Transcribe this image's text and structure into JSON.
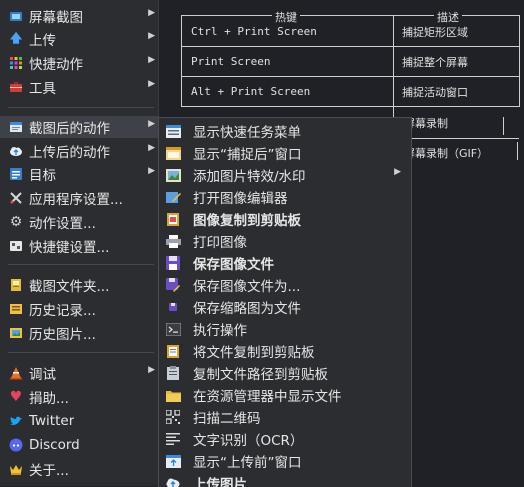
{
  "hotkeys": {
    "header_key": "热键",
    "header_desc": "描述",
    "rows": [
      {
        "key": "Ctrl + Print Screen",
        "desc": "捕捉矩形区域"
      },
      {
        "key": "Print Screen",
        "desc": "捕捉整个屏幕"
      },
      {
        "key": "Alt + Print Screen",
        "desc": "捕捉活动窗口"
      },
      {
        "key": "",
        "desc": "屏幕录制"
      },
      {
        "key": "",
        "desc": "屏幕录制（GIF）"
      }
    ]
  },
  "menu": {
    "items": [
      {
        "label": "屏幕截图",
        "icon": "screenshot-icon",
        "arrow": true
      },
      {
        "label": "上传",
        "icon": "upload-arrow-icon",
        "arrow": true
      },
      {
        "label": "快捷动作",
        "icon": "quick-actions-icon",
        "arrow": true
      },
      {
        "label": "工具",
        "icon": "toolbox-icon",
        "arrow": true
      },
      {
        "label": "截图后的动作",
        "icon": "after-capture-icon",
        "arrow": true
      },
      {
        "label": "上传后的动作",
        "icon": "cloud-icon",
        "arrow": true
      },
      {
        "label": "目标",
        "icon": "destination-icon",
        "arrow": true
      },
      {
        "label": "应用程序设置...",
        "icon": "wrench-icon",
        "arrow": false
      },
      {
        "label": "动作设置...",
        "icon": "gear-icon",
        "arrow": false
      },
      {
        "label": "快捷键设置...",
        "icon": "keyboard-icon",
        "arrow": false
      },
      {
        "label": "截图文件夹...",
        "icon": "folder-icon",
        "arrow": false
      },
      {
        "label": "历史记录...",
        "icon": "history-icon",
        "arrow": false
      },
      {
        "label": "历史图片...",
        "icon": "image-history-icon",
        "arrow": false
      },
      {
        "label": "调试",
        "icon": "cone-icon",
        "arrow": true
      },
      {
        "label": "捐助...",
        "icon": "heart-icon",
        "arrow": false
      },
      {
        "label": "Twitter",
        "icon": "twitter-icon",
        "arrow": false
      },
      {
        "label": "Discord",
        "icon": "discord-icon",
        "arrow": false
      },
      {
        "label": "关于...",
        "icon": "crown-icon",
        "arrow": false
      }
    ]
  },
  "submenu": {
    "items": [
      {
        "label": "显示快速任务菜单",
        "icon": "task-menu-icon",
        "bold": false,
        "arrow": false
      },
      {
        "label": "显示“捕捉后”窗口",
        "icon": "window-icon",
        "bold": false,
        "arrow": false
      },
      {
        "label": "添加图片特效/水印",
        "icon": "effects-icon",
        "bold": false,
        "arrow": true
      },
      {
        "label": "打开图像编辑器",
        "icon": "image-editor-icon",
        "bold": false,
        "arrow": false
      },
      {
        "label": "图像复制到剪贴板",
        "icon": "copy-image-icon",
        "bold": true,
        "arrow": false
      },
      {
        "label": "打印图像",
        "icon": "printer-icon",
        "bold": false,
        "arrow": false
      },
      {
        "label": "保存图像文件",
        "icon": "save-icon",
        "bold": true,
        "arrow": false
      },
      {
        "label": "保存图像文件为...",
        "icon": "save-as-icon",
        "bold": false,
        "arrow": false
      },
      {
        "label": "保存缩略图为文件",
        "icon": "thumbnail-icon",
        "bold": false,
        "arrow": false
      },
      {
        "label": "执行操作",
        "icon": "terminal-icon",
        "bold": false,
        "arrow": false
      },
      {
        "label": "将文件复制到剪贴板",
        "icon": "copy-file-icon",
        "bold": false,
        "arrow": false
      },
      {
        "label": "复制文件路径到剪贴板",
        "icon": "clipboard-icon",
        "bold": false,
        "arrow": false
      },
      {
        "label": "在资源管理器中显示文件",
        "icon": "explorer-folder-icon",
        "bold": false,
        "arrow": false
      },
      {
        "label": "扫描二维码",
        "icon": "qr-code-icon",
        "bold": false,
        "arrow": false
      },
      {
        "label": "文字识别（OCR）",
        "icon": "ocr-icon",
        "bold": false,
        "arrow": false
      },
      {
        "label": "显示“上传前”窗口",
        "icon": "before-upload-window-icon",
        "bold": false,
        "arrow": false
      },
      {
        "label": "上传图片",
        "icon": "upload-image-icon",
        "bold": true,
        "arrow": false
      }
    ]
  },
  "colors": {
    "menu_bg": "#2b2d31",
    "highlight": "#3e4248",
    "page_bg": "#1f2126"
  }
}
